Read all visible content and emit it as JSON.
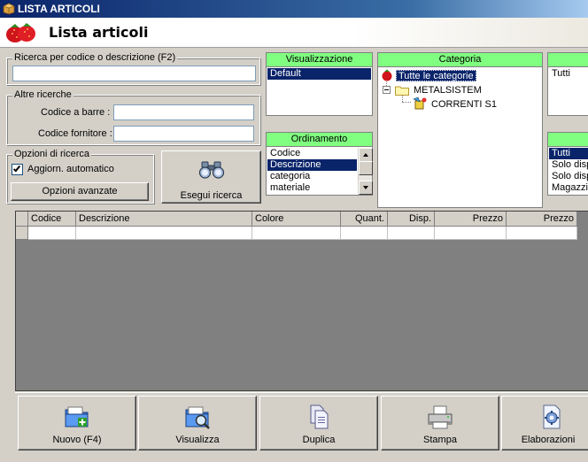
{
  "window": {
    "title": "LISTA ARTICOLI"
  },
  "header": {
    "title": "Lista articoli"
  },
  "search": {
    "label": "Ricerca per codice o descrizione (F2)",
    "value": ""
  },
  "other_search": {
    "label": "Altre ricerche",
    "barcode_label": "Codice a barre :",
    "barcode_value": "",
    "supplier_code_label": "Codice fornitore :",
    "supplier_code_value": ""
  },
  "search_options": {
    "label": "Opzioni di ricerca",
    "auto_update_label": "Aggiorn. automatico",
    "auto_update_checked": true,
    "advanced_button": "Opzioni avanzate"
  },
  "run_search_button": "Esegui ricerca",
  "visualizzazione": {
    "title": "Visualizzazione",
    "items": [
      "Default"
    ],
    "selected": 0
  },
  "ordinamento": {
    "title": "Ordinamento",
    "items": [
      "Codice",
      "Descrizione",
      "categoria",
      "materiale"
    ],
    "selected": 1
  },
  "categoria": {
    "title": "Categoria",
    "root": "Tutte le categorie",
    "node": "METALSISTEM",
    "leaf": "CORRENTI S1"
  },
  "right_panel_top": {
    "items": [
      "Tutti"
    ]
  },
  "right_panel_bottom": {
    "items": [
      "Tutti",
      "Solo disp",
      "Solo disp",
      "Magazzin"
    ]
  },
  "grid": {
    "columns": [
      "Codice",
      "Descrizione",
      "Colore",
      "Quant.",
      "Disp.",
      "Prezzo",
      "Prezzo"
    ]
  },
  "actions": [
    "Nuovo (F4)",
    "Visualizza",
    "Duplica",
    "Stampa",
    "Elaborazioni"
  ],
  "icons": {
    "app": "box-icon",
    "header": "strawberry-icon",
    "search": "binoculars-icon",
    "new": "folder-add-icon",
    "view": "folder-search-icon",
    "duplicate": "documents-icon",
    "print": "printer-icon",
    "process": "gear-document-icon"
  },
  "colors": {
    "panel_header": "#80ff80",
    "selection": "#0a246a",
    "grid_bg": "#808080"
  }
}
